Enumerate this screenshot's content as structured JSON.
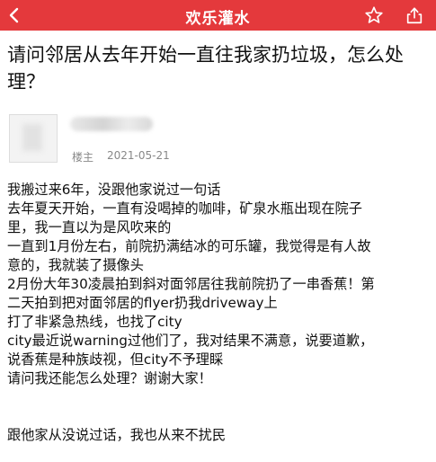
{
  "header": {
    "title": "欢乐灌水",
    "icons": [
      "back-arrow-icon",
      "star-icon",
      "share-icon"
    ],
    "color": "#e4393c"
  },
  "post": {
    "title_lines": [
      "请问邻居从去年开始一直往我家扔垃圾，怎么处",
      "理？"
    ],
    "author_role": "楼主",
    "date": "2021-05-21",
    "body_lines": [
      "我搬过来6年，没跟他家说过一句话",
      "去年夏天开始，一直有没喝掉的咖啡，矿泉水瓶出现在院子",
      "里，我一直以为是风吹来的",
      "一直到1月份左右，前院扔满结冰的可乐罐，我觉得是有人故",
      "意的，我就装了摄像头",
      "2月份大年30凌晨拍到斜对面邻居往我前院扔了一串香蕉！第",
      "二天拍到把对面邻居的flyer扔我driveway上",
      "打了非紧急热线，也找了city",
      "city最近说warning过他们了，我对结果不满意，说要道歉，",
      "说香蕉是种族歧视，但city不予理睬",
      "请问我还能怎么处理？谢谢大家！"
    ],
    "footer_line": "跟他家从没说过话，我也从来不扰民"
  }
}
